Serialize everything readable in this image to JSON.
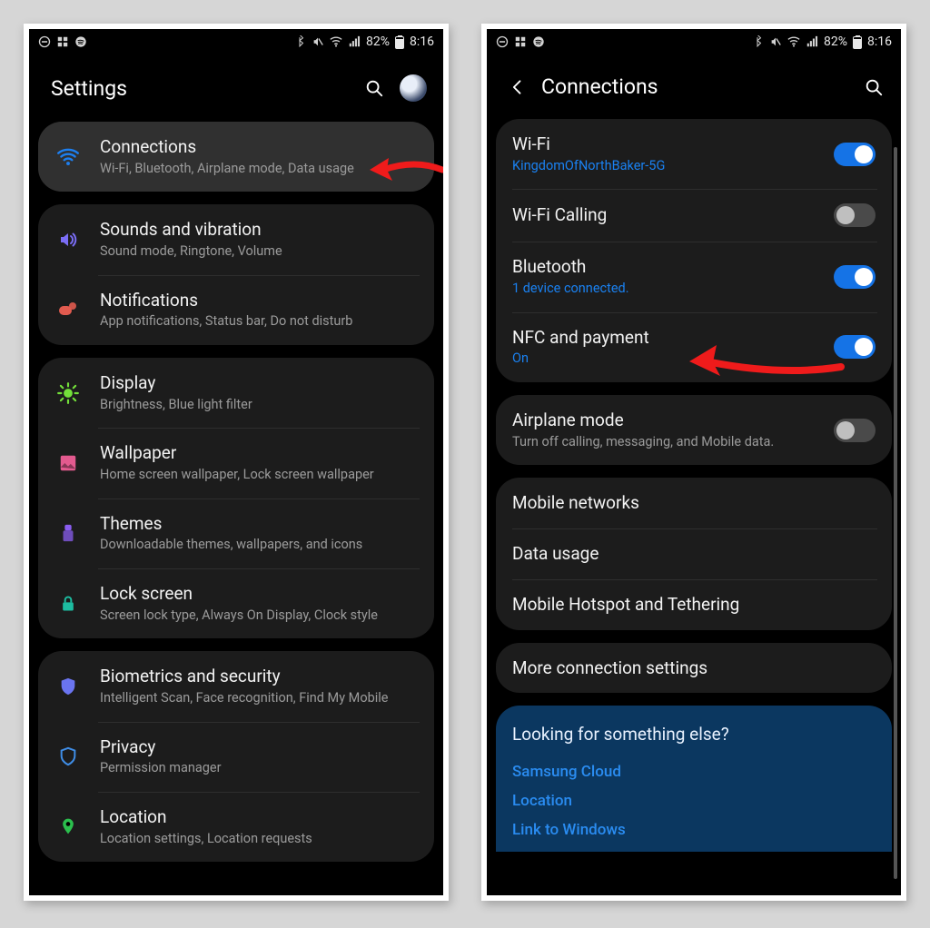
{
  "status": {
    "battery_percent": "82%",
    "time": "8:16"
  },
  "left": {
    "header_title": "Settings",
    "groups": [
      {
        "key": "grp0",
        "items": [
          {
            "key": "connections",
            "title": "Connections",
            "sub": "Wi-Fi, Bluetooth, Airplane mode, Data usage",
            "icon": "wifi",
            "icon_color": "#1d7ff0",
            "highlight": true
          }
        ]
      },
      {
        "key": "grp1",
        "items": [
          {
            "key": "sounds",
            "title": "Sounds and vibration",
            "sub": "Sound mode, Ringtone, Volume",
            "icon": "speaker",
            "icon_color": "#7a6df5"
          },
          {
            "key": "notifications",
            "title": "Notifications",
            "sub": "App notifications, Status bar, Do not disturb",
            "icon": "dot",
            "icon_color": "#e15b4f"
          }
        ]
      },
      {
        "key": "grp2",
        "items": [
          {
            "key": "display",
            "title": "Display",
            "sub": "Brightness, Blue light filter",
            "icon": "sun",
            "icon_color": "#73e03a"
          },
          {
            "key": "wallpaper",
            "title": "Wallpaper",
            "sub": "Home screen wallpaper, Lock screen wallpaper",
            "icon": "wallpaper",
            "icon_color": "#e35a8f"
          },
          {
            "key": "themes",
            "title": "Themes",
            "sub": "Downloadable themes, wallpapers, and icons",
            "icon": "themes",
            "icon_color": "#8a5df0"
          },
          {
            "key": "lockscreen",
            "title": "Lock screen",
            "sub": "Screen lock type, Always On Display, Clock style",
            "icon": "lock",
            "icon_color": "#1dbca0"
          }
        ]
      },
      {
        "key": "grp3",
        "items": [
          {
            "key": "biometrics",
            "title": "Biometrics and security",
            "sub": "Intelligent Scan, Face recognition, Find My Mobile",
            "icon": "shield",
            "icon_color": "#6a74f0"
          },
          {
            "key": "privacy",
            "title": "Privacy",
            "sub": "Permission manager",
            "icon": "shield-outline",
            "icon_color": "#3f8de6"
          },
          {
            "key": "location",
            "title": "Location",
            "sub": "Location settings, Location requests",
            "icon": "pin",
            "icon_color": "#2bbf4d"
          }
        ]
      }
    ]
  },
  "right": {
    "header_title": "Connections",
    "groups": [
      {
        "key": "grpA",
        "items": [
          {
            "key": "wifi",
            "title": "Wi-Fi",
            "sub": "KingdomOfNorthBaker-5G",
            "sub_blue": true,
            "toggle": "on"
          },
          {
            "key": "wificalling",
            "title": "Wi-Fi Calling",
            "toggle": "off"
          },
          {
            "key": "bluetooth",
            "title": "Bluetooth",
            "sub": "1 device connected.",
            "sub_blue": true,
            "toggle": "on"
          },
          {
            "key": "nfc",
            "title": "NFC and payment",
            "sub": "On",
            "sub_blue": true,
            "toggle": "on"
          }
        ]
      },
      {
        "key": "grpB",
        "items": [
          {
            "key": "airplane",
            "title": "Airplane mode",
            "sub": "Turn off calling, messaging, and Mobile data.",
            "toggle": "off"
          }
        ]
      },
      {
        "key": "grpC",
        "items": [
          {
            "key": "mobilenet",
            "title": "Mobile networks"
          },
          {
            "key": "datausage",
            "title": "Data usage"
          },
          {
            "key": "hotspot",
            "title": "Mobile Hotspot and Tethering"
          }
        ]
      },
      {
        "key": "grpD",
        "items": [
          {
            "key": "more",
            "title": "More connection settings"
          }
        ]
      }
    ],
    "hint": {
      "title": "Looking for something else?",
      "links": [
        "Samsung Cloud",
        "Location",
        "Link to Windows"
      ]
    }
  }
}
